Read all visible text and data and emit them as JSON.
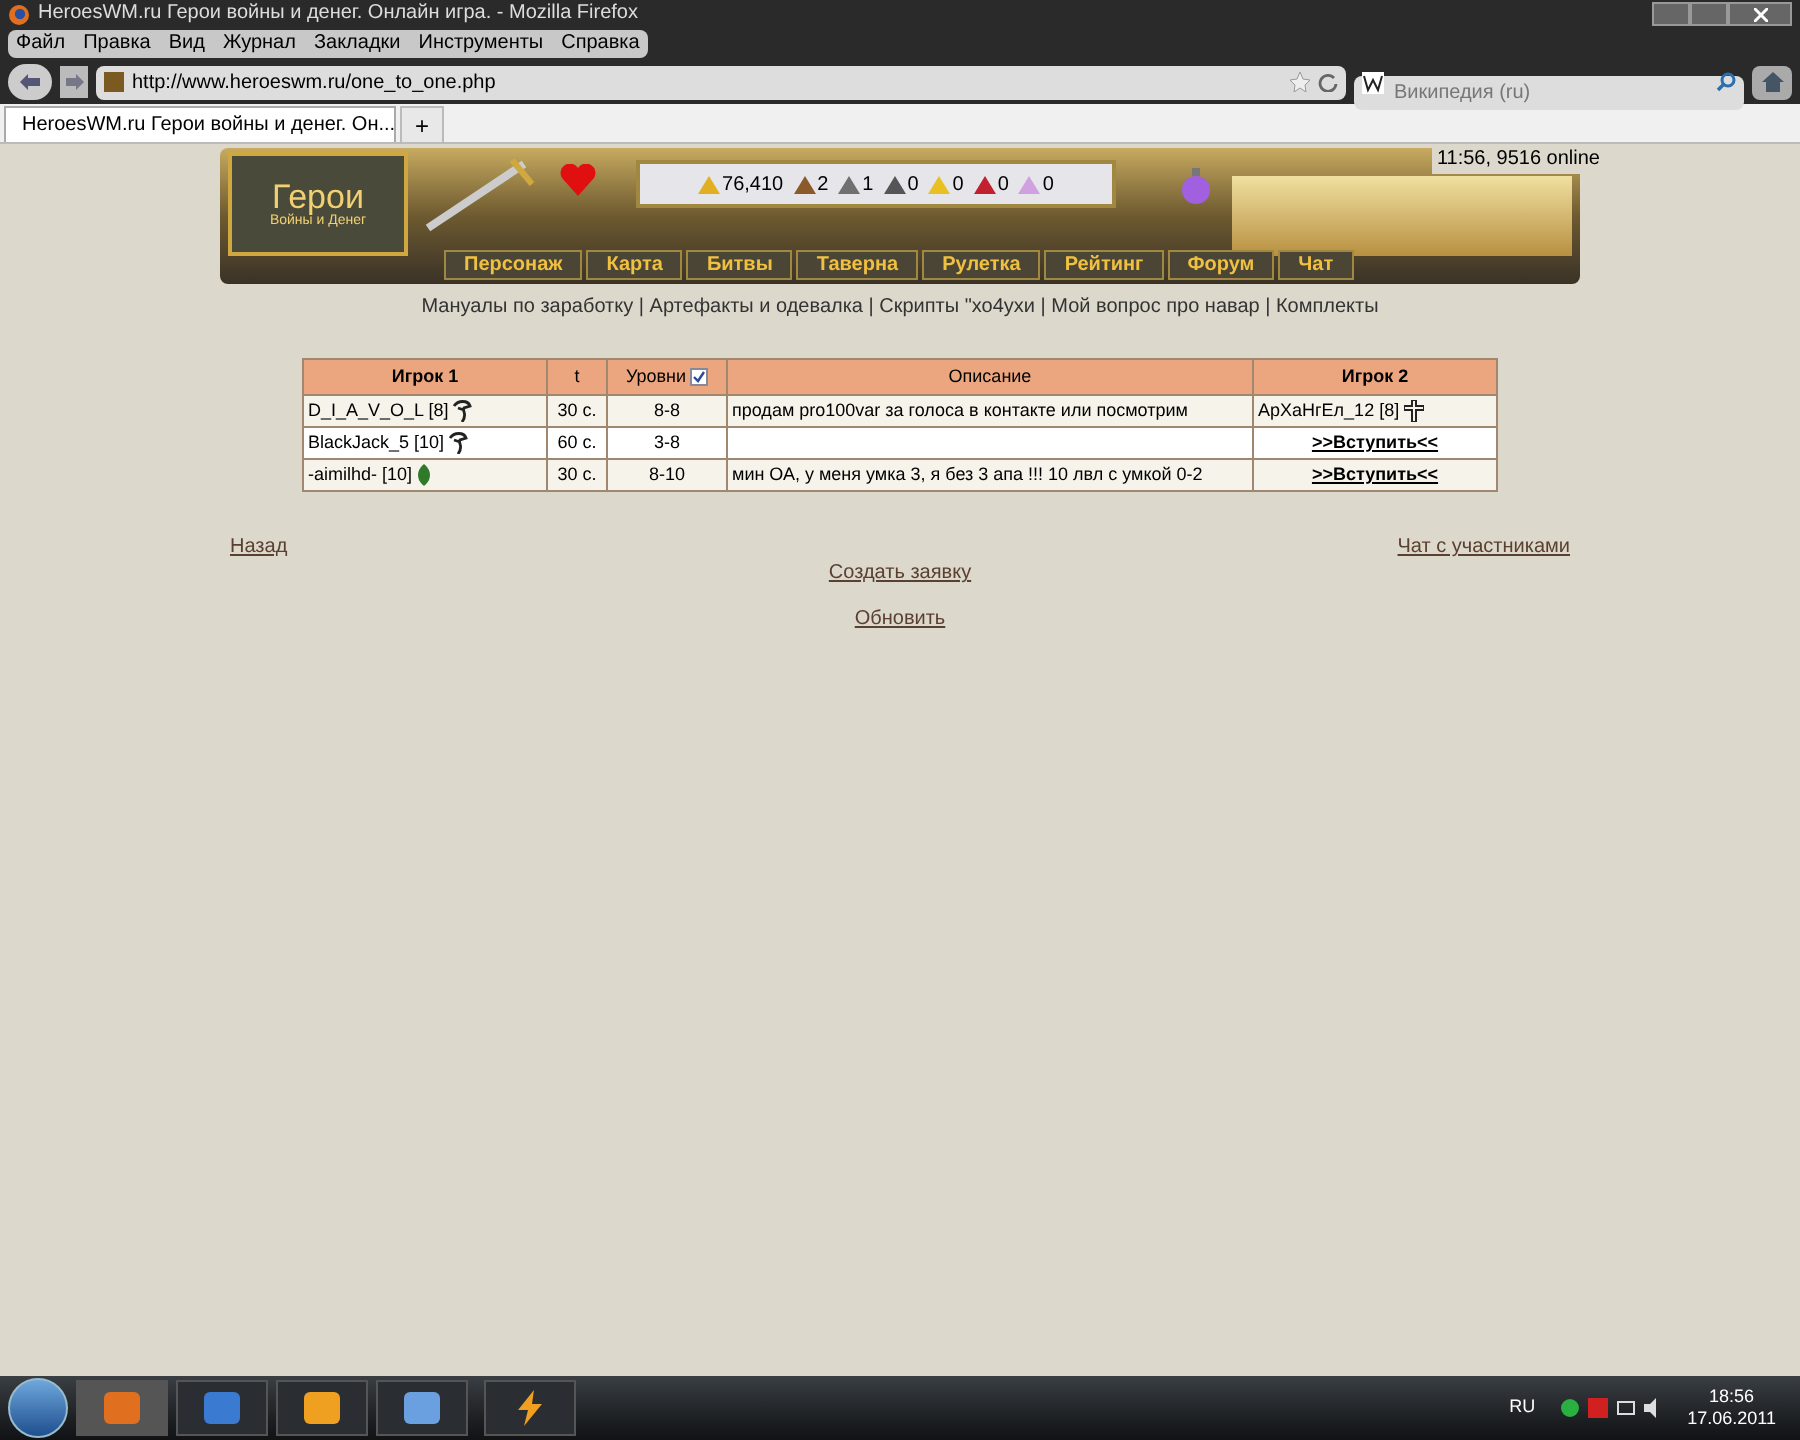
{
  "window": {
    "title": "HeroesWM.ru Герои войны и денег. Онлайн игра. - Mozilla Firefox"
  },
  "menu": [
    "Файл",
    "Правка",
    "Вид",
    "Журнал",
    "Закладки",
    "Инструменты",
    "Справка"
  ],
  "address": {
    "value": "http://www.heroeswm.ru/one_to_one.php"
  },
  "search": {
    "placeholder": "Википедия (ru)"
  },
  "tabs": [
    {
      "label": "HeroesWM.ru Герои войны и денег. Он...",
      "selected": true
    }
  ],
  "tab_add": "+",
  "header": {
    "logo_title": "Герои",
    "logo_subtitle": "Войны и Денег",
    "online": "11:56, 9516 online",
    "resources": [
      {
        "kind": "gold",
        "value": "76,410"
      },
      {
        "kind": "wood",
        "value": "2"
      },
      {
        "kind": "ore",
        "value": "1"
      },
      {
        "kind": "mercury",
        "value": "0"
      },
      {
        "kind": "sulfur",
        "value": "0"
      },
      {
        "kind": "crystal",
        "value": "0"
      },
      {
        "kind": "gems",
        "value": "0"
      }
    ],
    "nav": [
      "Персонаж",
      "Карта",
      "Битвы",
      "Таверна",
      "Рулетка",
      "Рейтинг",
      "Форум",
      "Чат"
    ],
    "links": "Мануалы по заработку | Артефакты и одевалка | Скрипты \"хо4ухи | Мой вопрос про навар | Комплекты"
  },
  "table": {
    "columns": [
      {
        "label": "Игрок 1"
      },
      {
        "label": "t"
      },
      {
        "label": "Уровни",
        "checked": true
      },
      {
        "label": "Описание"
      },
      {
        "label": "Игрок 2"
      }
    ],
    "rows": [
      {
        "player1": {
          "kind": "beast",
          "text": "D_I_A_V_O_L [8]"
        },
        "time": "30 с.",
        "levels": "8-8",
        "description": "продам pro100var за голоса в контакте или посмотрим",
        "player2": {
          "kind": "cross",
          "text": "АрХаНгЕл_12 [8]"
        }
      },
      {
        "player1": {
          "kind": "beast",
          "text": "BlackJack_5 [10]"
        },
        "time": "60 с.",
        "levels": "3-8",
        "description": "",
        "player2": {
          "kind": "join",
          "text": ">>Вступить<<"
        }
      },
      {
        "player1": {
          "kind": "leaf",
          "text": "-aimilhd- [10]"
        },
        "time": "30 с.",
        "levels": "8-10",
        "description": "мин ОА, у меня умка 3, я без 3 апа !!! 10 лвл с умкой 0-2",
        "player2": {
          "kind": "join",
          "text": ">>Вступить<<"
        }
      }
    ]
  },
  "links": {
    "back": "Назад",
    "chat": "Чат с участниками",
    "create": "Создать заявку",
    "refresh": "Обновить"
  },
  "taskbar": {
    "language": "RU",
    "time": "18:56",
    "date": "17.06.2011"
  }
}
